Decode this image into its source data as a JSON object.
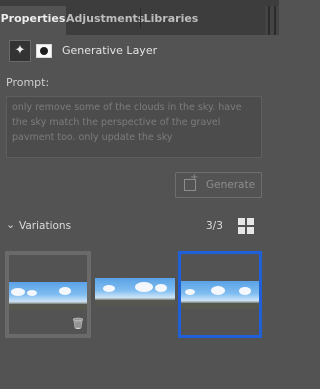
{
  "tabs": [
    "Properties",
    "Adjustments",
    "Libraries"
  ],
  "layer": {
    "name": "Generative Layer",
    "icon": "generative-fill-icon",
    "mask_icon": "layer-mask-icon"
  },
  "prompt": {
    "label": "Prompt:",
    "value": "only remove some of the clouds in the sky. have the sky match the perspective of the gravel pavment too. only update the sky"
  },
  "generate": {
    "label": "Generate",
    "icon": "generate-icon"
  },
  "variations": {
    "title": "Variations",
    "count": "3/3",
    "items": [
      "variation-1",
      "variation-2",
      "variation-3"
    ],
    "selected_index": 2
  },
  "colors": {
    "panel_bg": "#535353",
    "selection": "#1f5fd8"
  }
}
